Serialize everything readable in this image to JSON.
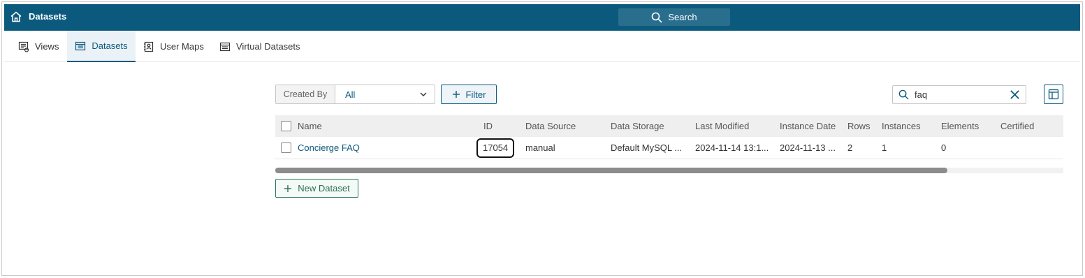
{
  "app": {
    "title": "Datasets"
  },
  "header": {
    "search_label": "Search"
  },
  "tabs": [
    {
      "label": "Views",
      "icon": "views-icon"
    },
    {
      "label": "Datasets",
      "icon": "dataset-grid-icon",
      "active": true
    },
    {
      "label": "User Maps",
      "icon": "user-maps-icon"
    },
    {
      "label": "Virtual Datasets",
      "icon": "virtual-dataset-icon"
    }
  ],
  "toolbar": {
    "created_by_label": "Created By",
    "created_by_value": "All",
    "filter_label": "Filter",
    "search_value": "faq"
  },
  "table": {
    "columns": [
      "Name",
      "ID",
      "Data Source",
      "Data Storage",
      "Last Modified",
      "Instance Date",
      "Rows",
      "Instances",
      "Elements",
      "Certified"
    ],
    "rows": [
      {
        "name": "Concierge FAQ",
        "id": "17054",
        "data_source": "manual",
        "data_storage": "Default MySQL ...",
        "last_modified": "2024-11-14 13:1...",
        "instance_date": "2024-11-13 ...",
        "rows": "2",
        "instances": "1",
        "elements": "0",
        "certified": ""
      }
    ]
  },
  "actions": {
    "new_dataset_label": "New Dataset"
  },
  "colors": {
    "brand": "#0b5a7d",
    "new_button": "#2b7a5c"
  }
}
